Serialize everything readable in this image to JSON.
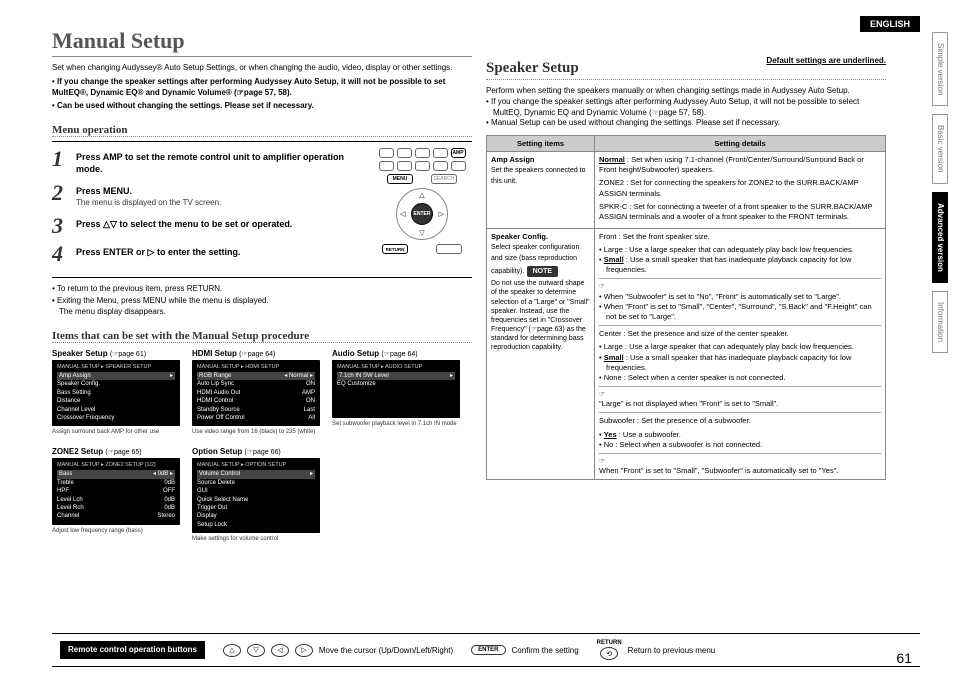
{
  "lang_badge": "ENGLISH",
  "page_number": "61",
  "tabs": [
    "Simple version",
    "Basic version",
    "Advanced version",
    "Information"
  ],
  "title": "Manual Setup",
  "intro": {
    "p1": "Set when changing Audyssey® Auto Setup Settings, or when changing the audio, video, display or other settings.",
    "b1": "If you change the speaker settings after performing Audyssey Auto Setup, it will not be possible to set MultEQ®, Dynamic EQ® and Dynamic Volume® (☞page 57, 58).",
    "b2": "Can be used without changing the settings. Please set if necessary."
  },
  "menu_op_heading": "Menu operation",
  "steps": [
    {
      "num": "1",
      "text": "Press AMP to set the remote control unit to amplifier operation mode."
    },
    {
      "num": "2",
      "text": "Press MENU.",
      "sub": "The menu is displayed on the TV screen."
    },
    {
      "num": "3",
      "text": "Press △▽ to select the menu to be set or operated."
    },
    {
      "num": "4",
      "text": "Press ENTER or ▷ to enter the setting."
    }
  ],
  "remote_labels": {
    "amp": "AMP",
    "menu": "MENU",
    "return": "RETURN",
    "search": "SEARCH",
    "enter": "ENTER"
  },
  "after_steps": {
    "l1": "To return to the previous item, press RETURN.",
    "l2a": "Exiting the Menu, press MENU while the menu is displayed.",
    "l2b": "The menu display disappears."
  },
  "items_heading": "Items that can be set with the Manual Setup procedure",
  "panels": [
    {
      "title": "Speaker Setup",
      "ref": "(☞page 61)",
      "crumb": "MANUAL SETUP ▸ SPEAKER SETUP",
      "rows": [
        [
          "Amp Assign",
          ""
        ],
        [
          "Speaker Config.",
          ""
        ],
        [
          "Bass Setting",
          ""
        ],
        [
          "Distance",
          ""
        ],
        [
          "Channel Level",
          ""
        ],
        [
          "Crossover Frequency",
          ""
        ]
      ],
      "foot": "Assign surround back AMP for other use"
    },
    {
      "title": "HDMI Setup",
      "ref": "(☞page 64)",
      "crumb": "MANUAL SETUP ▸ HDMI SETUP",
      "rows": [
        [
          "RGB Range",
          "Normal"
        ],
        [
          "Auto Lip Sync",
          "ON"
        ],
        [
          "HDMI Audio Out",
          "AMP"
        ],
        [
          "HDMI Control",
          "ON"
        ],
        [
          "Standby Source",
          "Last"
        ],
        [
          "Power Off Control",
          "All"
        ]
      ],
      "foot": "Use video range from 16 (black) to 235 (white)"
    },
    {
      "title": "Audio Setup",
      "ref": "(☞page 64)",
      "crumb": "MANUAL SETUP ▸ AUDIO SETUP",
      "rows": [
        [
          "7.1ch IN SW Level",
          ""
        ],
        [
          "EQ Customize",
          ""
        ]
      ],
      "foot": "Set subwoofer playback level in 7.1ch IN mode"
    },
    {
      "title": "ZONE2 Setup",
      "ref": "(☞page 65)",
      "crumb": "MANUAL SETUP ▸ ZONE2 SETUP       [1/2]",
      "rows": [
        [
          "Bass",
          "0dB"
        ],
        [
          "Treble",
          "0dB"
        ],
        [
          "HPF",
          "OFF"
        ],
        [
          "Level Lch",
          "0dB"
        ],
        [
          "Level Rch",
          "0dB"
        ],
        [
          "Channel",
          "Stereo"
        ]
      ],
      "foot": "Adjust low frequency range (bass)"
    },
    {
      "title": "Option Setup",
      "ref": "(☞page 66)",
      "crumb": "MANUAL SETUP ▸ OPTION SETUP",
      "rows": [
        [
          "Volume Control",
          ""
        ],
        [
          "Source Delete",
          ""
        ],
        [
          "GUI",
          ""
        ],
        [
          "Quick Select Name",
          ""
        ],
        [
          "Trigger Out",
          ""
        ],
        [
          "Display",
          ""
        ],
        [
          "Setup Lock",
          ""
        ]
      ],
      "foot": "Make settings for volume control"
    }
  ],
  "speaker_heading": "Speaker Setup",
  "default_note": "Default settings are underlined.",
  "rintro": {
    "p1": "Perform when setting the speakers manually or when changing settings made in Audyssey Auto Setup.",
    "b1": "If you change the speaker settings after performing Audyssey Auto Setup, it will not be possible to select MultEQ, Dynamic EQ and Dynamic Volume (☞page 57, 58).",
    "b2": "Manual Setup can be used without changing the settings. Please set if necessary."
  },
  "table": {
    "h1": "Setting items",
    "h2": "Setting details",
    "amp_assign": {
      "name": "Amp Assign",
      "desc": "Set the speakers connected to this unit.",
      "d_normal": "Normal : Set when using 7.1-channel (Front/Center/Surround/Surround Back or Front height/Subwoofer) speakers.",
      "d_zone2": "ZONE2 : Set for connecting the speakers for ZONE2 to the SURR.BACK/AMP ASSIGN terminals.",
      "d_spkrc": "SPKR-C : Set for connecting a tweeter of a front speaker to the SURR.BACK/AMP ASSIGN terminals and a woofer of a front speaker to the FRONT terminals."
    },
    "speaker_config": {
      "name": "Speaker Config.",
      "desc": "Select speaker configuration and size (bass reproduction capability).",
      "note_label": "NOTE",
      "note": "Do not use the outward shape of the speaker to determine selection of a \"Large\" or \"Small\" speaker. Instead, use the frequencies set in \"Crossover Frequency\" (☞page 63) as the standard for determining bass reproduction capability.",
      "front_h": "Front : Set the front speaker size.",
      "front_large": "Large : Use a large speaker that can adequately play back low frequencies.",
      "front_small": "Small : Use a small speaker that has inadequate playback capacity for low frequencies.",
      "p1": "When \"Subwoofer\" is set to \"No\", \"Front\" is automatically set to \"Large\".",
      "p2": "When \"Front\" is set to \"Small\", \"Center\", \"Surround\", \"S.Back\" and \"F.Height\" can not be set to \"Large\".",
      "center_h": "Center : Set the presence and size of the center speaker.",
      "center_large": "Large : Use a large speaker that can adequately play back low frequencies.",
      "center_small": "Small : Use a small speaker that has inadequate playback capacity for low frequencies.",
      "center_none": "None : Select when a center speaker is not connected.",
      "p3": "\"Large\" is not displayed when \"Front\" is set to \"Small\".",
      "sub_h": "Subwoofer : Set the presence of a subwoofer.",
      "sub_yes": "Yes : Use a subwoofer.",
      "sub_no": "No : Select when a subwoofer is not connected.",
      "p4": "When \"Front\" is set to \"Small\", \"Subwoofer\" is automatically set to \"Yes\"."
    }
  },
  "footer": {
    "badge": "Remote control operation buttons",
    "cursor": "Move the cursor (Up/Down/Left/Right)",
    "enter": "Confirm the setting",
    "enter_btn": "ENTER",
    "return": "Return to previous menu",
    "return_btn": "RETURN"
  }
}
